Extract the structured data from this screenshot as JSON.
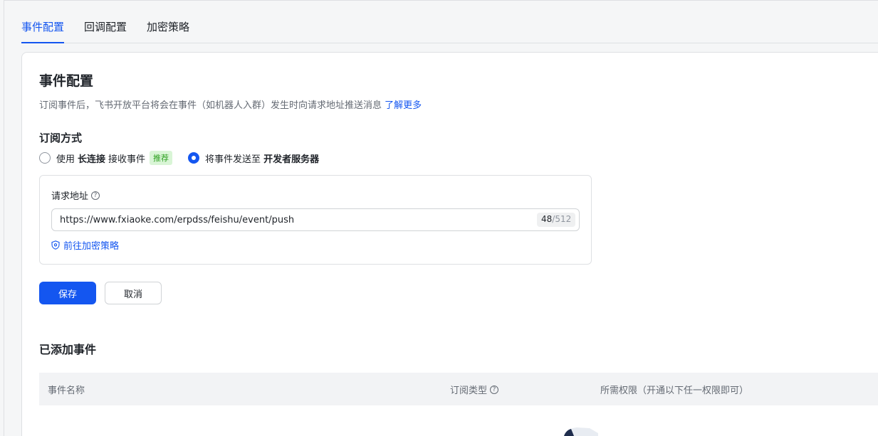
{
  "tabs": [
    {
      "label": "事件配置",
      "active": true
    },
    {
      "label": "回调配置",
      "active": false
    },
    {
      "label": "加密策略",
      "active": false
    }
  ],
  "section": {
    "title": "事件配置",
    "description": "订阅事件后，飞书开放平台将会在事件（如机器人入群）发生时向请求地址推送消息",
    "learn_more": "了解更多"
  },
  "subscription": {
    "title": "订阅方式",
    "option1": {
      "prefix": "使用",
      "bold": "长连接",
      "suffix": "接收事件",
      "tag": "推荐",
      "checked": false
    },
    "option2": {
      "prefix": "将事件发送至",
      "bold": "开发者服务器",
      "checked": true
    }
  },
  "request_url": {
    "label": "请求地址",
    "value": "https://www.fxiaoke.com/erpdss/feishu/event/push",
    "count_current": "48",
    "count_max": "/512",
    "encrypt_link": "前往加密策略"
  },
  "actions": {
    "save": "保存",
    "cancel": "取消"
  },
  "added_events": {
    "title": "已添加事件",
    "columns": [
      "事件名称",
      "订阅类型",
      "所需权限（开通以下任一权限即可）"
    ]
  },
  "colors": {
    "accent": "#1456f0",
    "tag_bg": "#d9f5d6",
    "tag_text": "#2ea121"
  },
  "icons": {
    "help": "question-circle-icon",
    "shield": "shield-icon"
  }
}
